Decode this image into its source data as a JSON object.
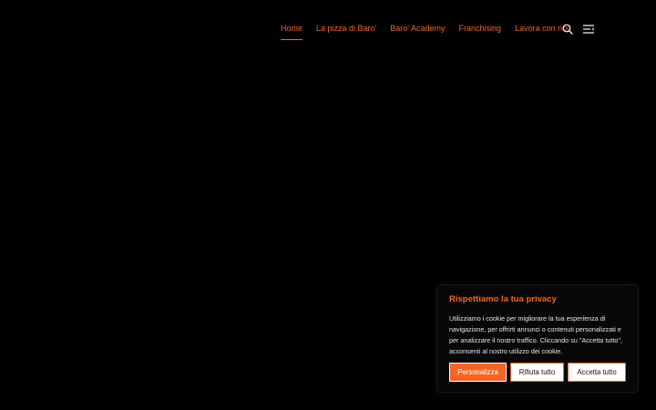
{
  "nav": {
    "items": [
      {
        "label": "Home",
        "active": true
      },
      {
        "label": "La pizza di Baro'"
      },
      {
        "label": "Baro' Academy"
      },
      {
        "label": "Franchising"
      },
      {
        "label": "Lavora con noi"
      }
    ],
    "icons": {
      "search": "search-icon",
      "menu": "menu-icon"
    }
  },
  "cookie": {
    "title": "Rispettiamo la tua privacy",
    "text": "Utilizziamo i cookie per migliorare la tua esperienza di navigazione, per offrirti annunci o contenuti personalizzati e per analizzare il nostro traffico. Cliccando su \"Accetta tutto\", acconsenti al nostro utilizzo dei cookie.",
    "buttons": {
      "customize": "Personalizza",
      "reject": "Rifiuta tutto",
      "accept": "Accetta tutto"
    }
  },
  "colors": {
    "accent": "#f26522",
    "background": "#000000"
  }
}
